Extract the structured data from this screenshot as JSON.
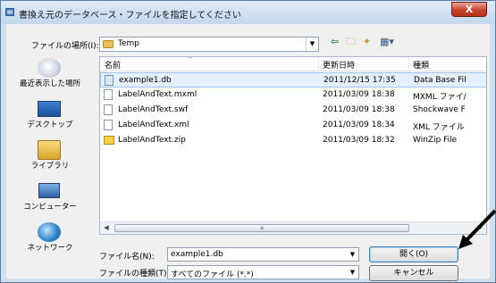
{
  "window": {
    "title": "書換え元のデータベース・ファイルを指定してください",
    "close_label": "X"
  },
  "toolbar": {
    "lookin_label": "ファイルの場所(I):",
    "lookin_value": "Temp",
    "icons": [
      "back-icon",
      "up-folder-icon",
      "new-folder-icon",
      "view-menu-icon"
    ]
  },
  "places": [
    {
      "label": "最近表示した場所",
      "icon": "recent-places-icon"
    },
    {
      "label": "デスクトップ",
      "icon": "desktop-icon"
    },
    {
      "label": "ライブラリ",
      "icon": "libraries-icon"
    },
    {
      "label": "コンピューター",
      "icon": "computer-icon"
    },
    {
      "label": "ネットワーク",
      "icon": "network-icon"
    }
  ],
  "filelist": {
    "columns": {
      "name": "名前",
      "date": "更新日時",
      "type": "種類"
    },
    "rows": [
      {
        "name": "example1.db",
        "date": "2011/12/15 17:35",
        "type": "Data Base Fil",
        "icon": "database-file-icon",
        "selected": true
      },
      {
        "name": "LabelAndText.mxml",
        "date": "2011/03/09 18:38",
        "type": "MXML ファイ/",
        "icon": "file-icon"
      },
      {
        "name": "LabelAndText.swf",
        "date": "2011/03/09 18:38",
        "type": "Shockwave F",
        "icon": "file-icon"
      },
      {
        "name": "LabelAndText.xml",
        "date": "2011/03/09 18:34",
        "type": "XML ファイル",
        "icon": "file-icon"
      },
      {
        "name": "LabelAndText.zip",
        "date": "2011/03/09 18:32",
        "type": "WinZip File",
        "icon": "zip-file-icon"
      }
    ]
  },
  "bottom": {
    "filename_label": "ファイル名(N):",
    "filename_value": "example1.db",
    "filetype_label": "ファイルの種類(T):",
    "filetype_value": "すべてのファイル (*.*)",
    "open_label": "開く(O)",
    "cancel_label": "キャンセル"
  },
  "colors": {
    "accent": "#3c7fb1",
    "selection": "#e4f0fb",
    "close": "#c8432c"
  }
}
